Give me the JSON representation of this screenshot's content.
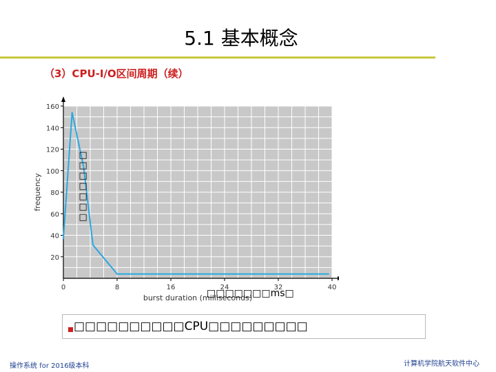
{
  "slide": {
    "title": "5.1 基本概念",
    "subtitle": "（3）CPU-I/O区间周期（续）",
    "overlay_vertical": "□□□□□□□",
    "overlay_xcaption": "□□□□□□□ms□",
    "note": "□□□□□□□□□□CPU□□□□□□□□□",
    "footer_left": "操作系统 for 2016级本科",
    "footer_right": "计算机学院航天软件中心"
  },
  "colors": {
    "title_rule": "#c8c83c",
    "subtitle": "#cc1f1f",
    "plot_background": "#c8c8c8",
    "line": "#29a8e0",
    "footer": "#1f3f8f"
  },
  "chart_data": {
    "type": "line",
    "xlabel": "burst duration (milliseconds)",
    "ylabel": "frequency",
    "xlim": [
      0,
      40
    ],
    "ylim": [
      0,
      160
    ],
    "x_ticks": [
      0,
      8,
      16,
      24,
      32,
      40
    ],
    "y_ticks": [
      20,
      40,
      60,
      80,
      100,
      120,
      140,
      160
    ],
    "grid": true,
    "series": [
      {
        "x": [
          0,
          1.3,
          3,
          4.4,
          8,
          39.5
        ],
        "y": [
          37,
          154,
          104,
          31,
          4,
          4
        ]
      }
    ]
  }
}
